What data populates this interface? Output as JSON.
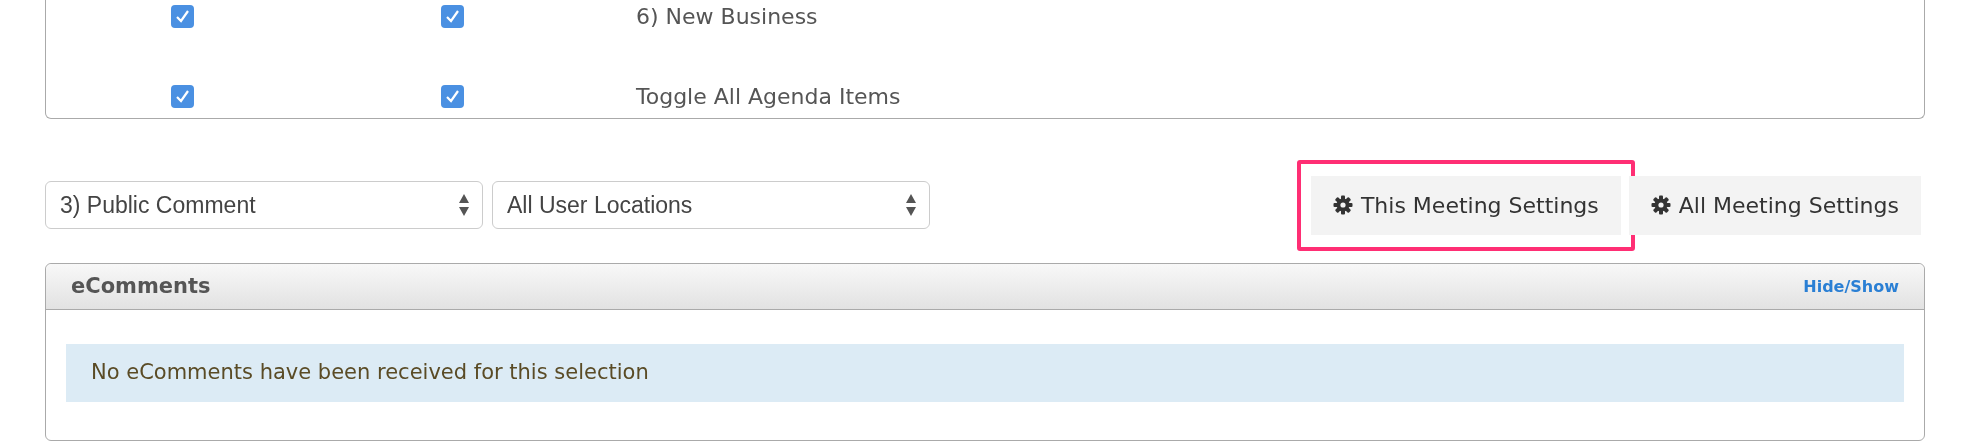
{
  "agenda_rows": [
    {
      "checked_1": true,
      "checked_2": true,
      "label": "6) New Business"
    },
    {
      "checked_1": true,
      "checked_2": true,
      "label": "Toggle All Agenda Items"
    }
  ],
  "filters": [
    {
      "value": "3) Public Comment"
    },
    {
      "value": "All User Locations"
    }
  ],
  "settings_buttons": [
    {
      "label": "This Meeting Settings",
      "highlighted": true
    },
    {
      "label": "All Meeting Settings",
      "highlighted": false
    }
  ],
  "ecomments": {
    "title": "eComments",
    "toggle_link": "Hide/Show",
    "message": "No eComments have been received for this selection"
  }
}
